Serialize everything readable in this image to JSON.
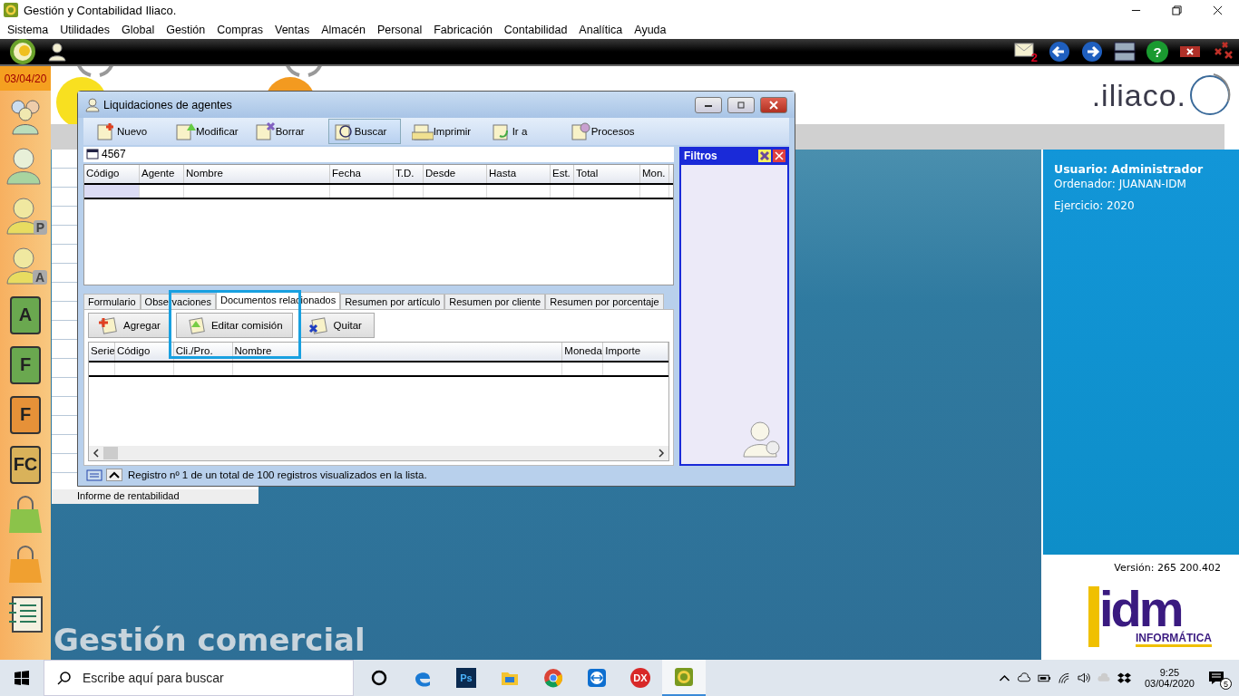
{
  "app_title": "Gestión y Contabilidad Iliaco.",
  "menu": [
    "Sistema",
    "Utilidades",
    "Global",
    "Gestión",
    "Compras",
    "Ventas",
    "Almacén",
    "Personal",
    "Fabricación",
    "Contabilidad",
    "Analítica",
    "Ayuda"
  ],
  "top_tools": [
    {
      "kind": "mail",
      "badge": "2"
    },
    {
      "kind": "back"
    },
    {
      "kind": "forward"
    },
    {
      "kind": "tile"
    },
    {
      "kind": "help",
      "glyph": "?"
    },
    {
      "kind": "close"
    },
    {
      "kind": "close-all"
    }
  ],
  "date": "03/04/20",
  "sidebar": [
    {
      "kind": "group"
    },
    {
      "kind": "person"
    },
    {
      "kind": "person",
      "letter": "P"
    },
    {
      "kind": "person",
      "letter": "A"
    },
    {
      "kind": "tile",
      "letter": "A",
      "color": "#6aa84f"
    },
    {
      "kind": "tile",
      "letter": "F",
      "color": "#6aa84f"
    },
    {
      "kind": "tile",
      "letter": "F",
      "color": "#e69138"
    },
    {
      "kind": "tile",
      "letter": "FC",
      "color": "#d9b25a"
    },
    {
      "kind": "bag",
      "color": "#8bc34a"
    },
    {
      "kind": "bag",
      "color": "#f0a030"
    },
    {
      "kind": "book"
    }
  ],
  "brand": ".iliaco.",
  "background_list": [
    "Informe de rentabilidad"
  ],
  "module_title": "Gestión comercial",
  "user_panel": {
    "user": "Usuario: Administrador",
    "computer": "Ordenador: JUANAN-IDM",
    "year": "Ejercicio: 2020",
    "version": "Versión: 265 200.402",
    "logo": "idm",
    "logo_sub": "INFORMÁTICA"
  },
  "dialog": {
    "title": "Liquidaciones de agentes",
    "toolbar": [
      {
        "label": "Nuevo",
        "kind": "new",
        "selected": false
      },
      {
        "label": "Modificar",
        "kind": "edit",
        "selected": false
      },
      {
        "label": "Borrar",
        "kind": "delete",
        "selected": false
      },
      {
        "label": "Buscar",
        "kind": "search",
        "selected": true
      },
      {
        "label": "Imprimir",
        "kind": "print",
        "selected": false
      },
      {
        "label": "Ir a",
        "kind": "goto",
        "selected": false
      },
      {
        "label": "Procesos",
        "kind": "process",
        "selected": false
      }
    ],
    "search_value": "4567",
    "columns": [
      "Código",
      "Agente",
      "Nombre",
      "Fecha",
      "T.D.",
      "Desde",
      "Hasta",
      "Est.",
      "Total",
      "Mon."
    ],
    "filters_title": "Filtros",
    "tabs": [
      {
        "label": "Formulario",
        "selected": false
      },
      {
        "label": "Observaciones",
        "selected": false
      },
      {
        "label": "Documentos relacionados",
        "selected": true
      },
      {
        "label": "Resumen por artículo",
        "selected": false
      },
      {
        "label": "Resumen por cliente",
        "selected": false
      },
      {
        "label": "Resumen por porcentaje",
        "selected": false
      }
    ],
    "actions": [
      {
        "label": "Agregar",
        "kind": "add"
      },
      {
        "label": "Editar comisión",
        "kind": "edit"
      },
      {
        "label": "Quitar",
        "kind": "remove"
      }
    ],
    "doc_columns": [
      "Serie",
      "Código",
      "Cli./Pro.",
      "Nombre",
      "Moneda",
      "Importe"
    ],
    "status": "Registro nº 1 de un total de 100 registros visualizados en la lista."
  },
  "taskbar": {
    "search_placeholder": "Escribe aquí para buscar",
    "apps": [
      {
        "kind": "cortana",
        "selected": false
      },
      {
        "kind": "edge",
        "selected": false
      },
      {
        "kind": "ps",
        "label": "Ps",
        "selected": false
      },
      {
        "kind": "folder",
        "selected": false
      },
      {
        "kind": "chrome",
        "selected": false
      },
      {
        "kind": "teamviewer",
        "selected": false
      },
      {
        "kind": "dx",
        "label": "DX",
        "selected": false
      },
      {
        "kind": "iliaco",
        "selected": true
      }
    ],
    "time": "9:25",
    "date": "03/04/2020",
    "notifications": "5"
  }
}
